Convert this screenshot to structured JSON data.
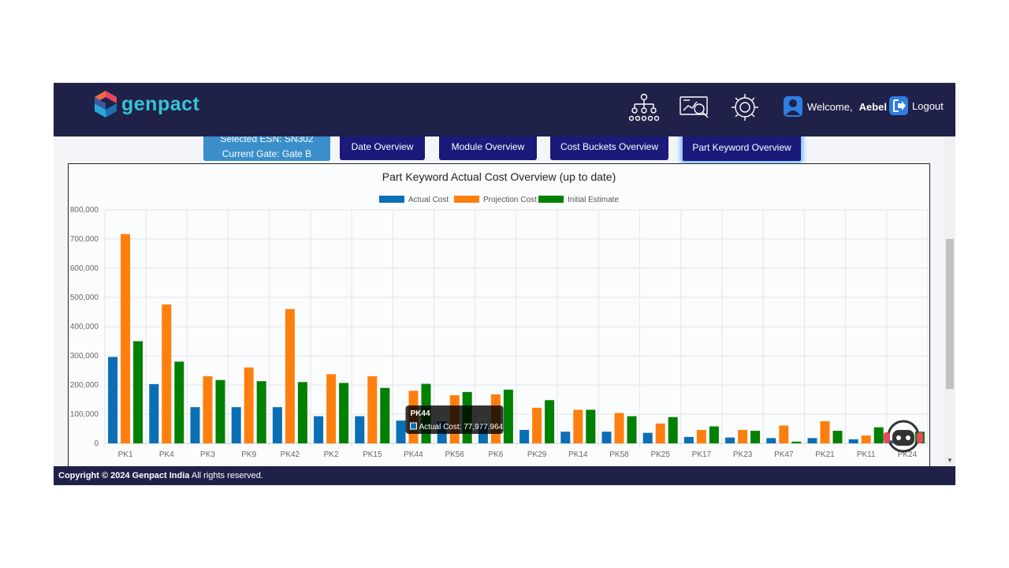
{
  "brand": {
    "name": "genpact"
  },
  "header": {
    "icons": [
      "hierarchy-icon",
      "analytics-icon",
      "settings-cost-icon"
    ],
    "welcome_label": "Welcome,",
    "username": "Aebel",
    "logout_label": "Logout"
  },
  "selection": {
    "esn_line": "Selected ESN: SN302",
    "gate_line": "Current Gate: Gate B"
  },
  "tabs": [
    {
      "label": "Date Overview",
      "active": false
    },
    {
      "label": "Module Overview",
      "active": false
    },
    {
      "label": "Cost Buckets Overview",
      "active": false
    },
    {
      "label": "Part Keyword Overview",
      "active": true
    }
  ],
  "tooltip": {
    "title": "PK44",
    "line": "Actual Cost: 77,977.964"
  },
  "footer": {
    "copyright": "Copyright © 2024 Genpact India",
    "rights": "All rights reserved."
  },
  "colors": {
    "actual": "#0a6fb5",
    "projection": "#ff7f0e",
    "initial": "#008000",
    "navbar": "#1f2148"
  },
  "chart_data": {
    "type": "bar",
    "title": "Part Keyword Actual Cost Overview (up to date)",
    "categories": [
      "PK1",
      "PK4",
      "PK3",
      "PK9",
      "PK42",
      "PK2",
      "PK15",
      "PK44",
      "PK56",
      "PK6",
      "PK29",
      "PK14",
      "PK58",
      "PK25",
      "PK17",
      "PK23",
      "PK47",
      "PK21",
      "PK11",
      "PK24"
    ],
    "series": [
      {
        "name": "Actual Cost",
        "color": "#0a6fb5",
        "values": [
          296000,
          203000,
          124000,
          124000,
          124000,
          93000,
          93000,
          77978,
          75000,
          70000,
          46000,
          40000,
          40000,
          36000,
          22000,
          20000,
          18000,
          18000,
          14000,
          10000
        ]
      },
      {
        "name": "Projection Cost",
        "color": "#ff7f0e",
        "values": [
          717000,
          476000,
          230000,
          260000,
          460000,
          237000,
          230000,
          180000,
          165000,
          168000,
          122000,
          115000,
          104000,
          68000,
          46000,
          46000,
          61000,
          76000,
          27000,
          20000
        ]
      },
      {
        "name": "Initial Estimate",
        "color": "#008000",
        "values": [
          350000,
          280000,
          217000,
          213000,
          210000,
          207000,
          190000,
          204000,
          176000,
          184000,
          148000,
          115000,
          93000,
          90000,
          58000,
          43000,
          6000,
          43000,
          55000,
          40000
        ]
      }
    ],
    "ylim": [
      0,
      800000
    ],
    "yticks": [
      "0",
      "100,000",
      "200,000",
      "300,000",
      "400,000",
      "500,000",
      "600,000",
      "700,000",
      "800,000"
    ],
    "legend_position": "top",
    "grid": true
  }
}
